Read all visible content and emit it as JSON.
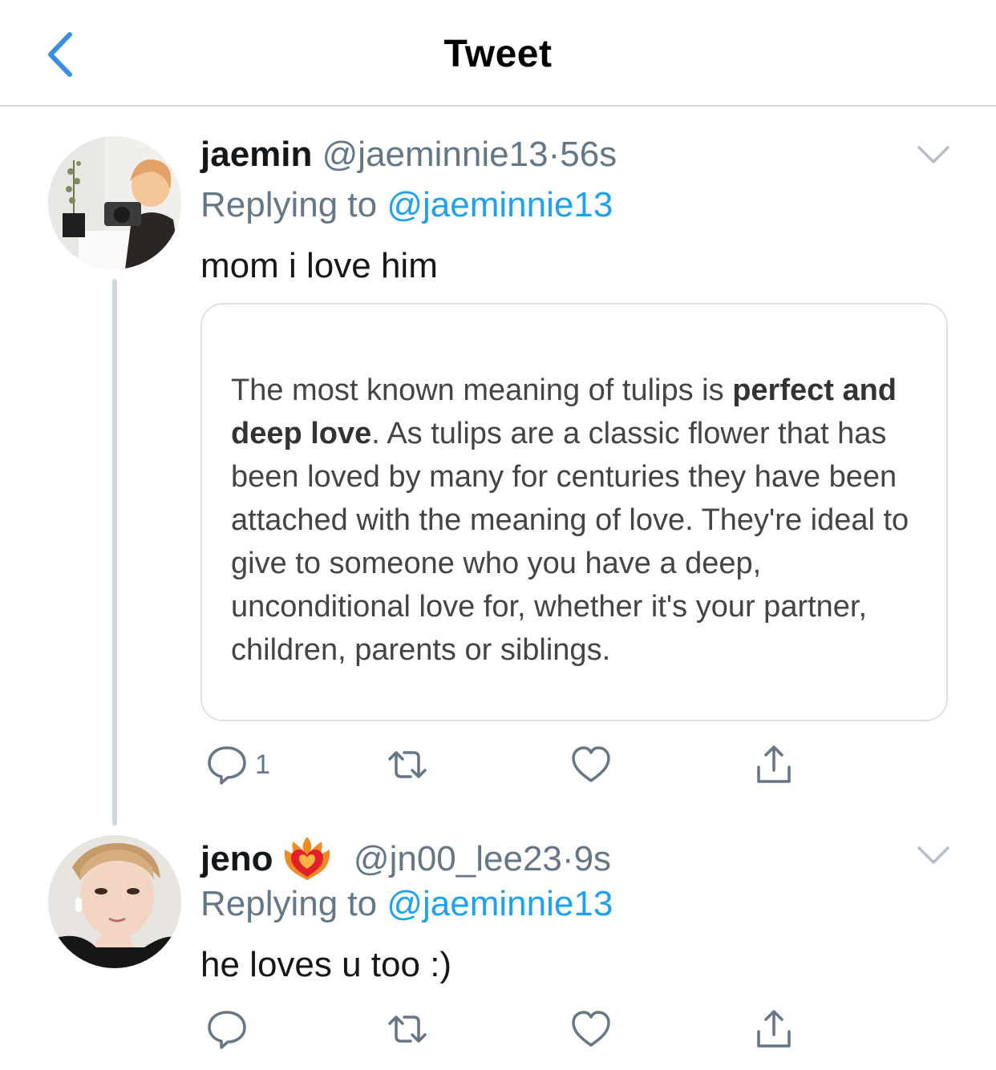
{
  "nav": {
    "title": "Tweet"
  },
  "tweets": [
    {
      "display_name": "jaemin",
      "handle": "@jaeminnie13",
      "time": "56s",
      "replying_prefix": "Replying to ",
      "replying_handle": "@jaeminnie13",
      "text": "mom i love him",
      "quote": {
        "part1": "The most known meaning of tulips is ",
        "bold": "perfect and deep love",
        "part2": ". As tulips are a classic flower that has been loved by many for centuries they have been attached with the meaning of love. They're ideal to give to someone who you have a deep, unconditional love for, whether it's your partner, children, parents or siblings."
      },
      "reply_count": "1"
    },
    {
      "display_name": "jeno",
      "name_emoji": "heart-on-fire",
      "handle": "@jn00_lee23",
      "time": "9s",
      "replying_prefix": "Replying to ",
      "replying_handle": "@jaeminnie13",
      "text": "he loves u too :)",
      "reply_count": ""
    }
  ],
  "separator": "·",
  "colors": {
    "link": "#1da1f2",
    "secondary_text": "#657786",
    "thread_line": "#cdd5dd",
    "nav_back": "#3b8ee0"
  },
  "icons": [
    "back-chevron-icon",
    "caret-down-icon",
    "reply-icon",
    "retweet-icon",
    "like-icon",
    "share-icon"
  ]
}
